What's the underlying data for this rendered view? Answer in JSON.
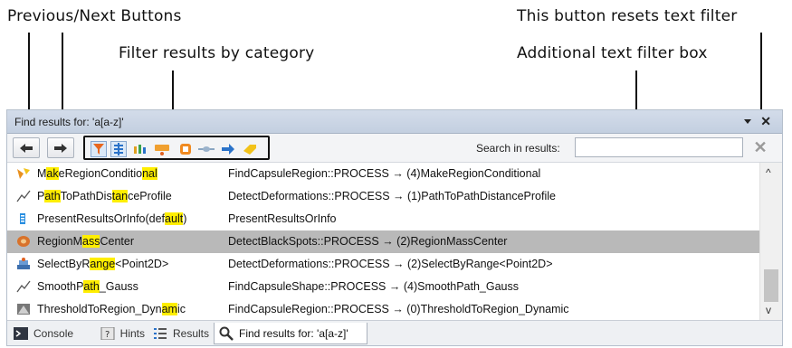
{
  "annotations": {
    "prev_next": "Previous/Next Buttons",
    "reset_filter": "This button resets text filter",
    "filter_category": "Filter results by category",
    "text_filter": "Additional text filter box"
  },
  "panel": {
    "title": "Find results for: 'a[a-z]'"
  },
  "toolbar": {
    "search_label": "Search in results:",
    "search_value": ""
  },
  "results": [
    {
      "icon": "region-filter-icon",
      "name_parts": [
        "M",
        "ak",
        "eRegionConditio",
        "nal",
        ""
      ],
      "path": "FindCapsuleRegion::PROCESS → (4)MakeRegionConditional"
    },
    {
      "icon": "path-icon",
      "name_parts": [
        "P",
        "ath",
        "ToPathDis",
        "tan",
        "ceProfile"
      ],
      "path": "DetectDeformations::PROCESS → (1)PathToPathDistanceProfile"
    },
    {
      "icon": "info-icon",
      "name_parts": [
        "PresentResultsOrInfo(def",
        "ault",
        ")",
        "",
        ""
      ],
      "path": "PresentResultsOrInfo"
    },
    {
      "icon": "region-icon",
      "name_parts": [
        "RegionM",
        "ass",
        "Center",
        "",
        ""
      ],
      "path": "DetectBlackSpots::PROCESS → (2)RegionMassCenter"
    },
    {
      "icon": "select-icon",
      "name_parts": [
        "SelectByR",
        "ange",
        "<Point2D>",
        "",
        ""
      ],
      "path": "DetectDeformations::PROCESS → (2)SelectByRange<Point2D>"
    },
    {
      "icon": "path-icon",
      "name_parts": [
        "SmoothP",
        "ath",
        "_Gauss",
        "",
        ""
      ],
      "path": "FindCapsuleShape::PROCESS → (4)SmoothPath_Gauss"
    },
    {
      "icon": "threshold-icon",
      "name_parts": [
        "ThresholdToRegion_Dyn",
        "am",
        "ic",
        "",
        ""
      ],
      "path": "FindCapsuleRegion::PROCESS → (0)ThresholdToRegion_Dynamic"
    }
  ],
  "tabs": [
    {
      "label": "Console",
      "icon": "console-icon"
    },
    {
      "label": "Hints",
      "icon": "hints-icon"
    },
    {
      "label": "Results",
      "icon": "results-icon"
    },
    {
      "label": "Find results for: 'a[a-z]'",
      "icon": "search-icon"
    }
  ],
  "colors": {
    "highlight": "#ffee00",
    "selected_row": "#b9b9b9",
    "title_bar": "#c9d4e4"
  }
}
